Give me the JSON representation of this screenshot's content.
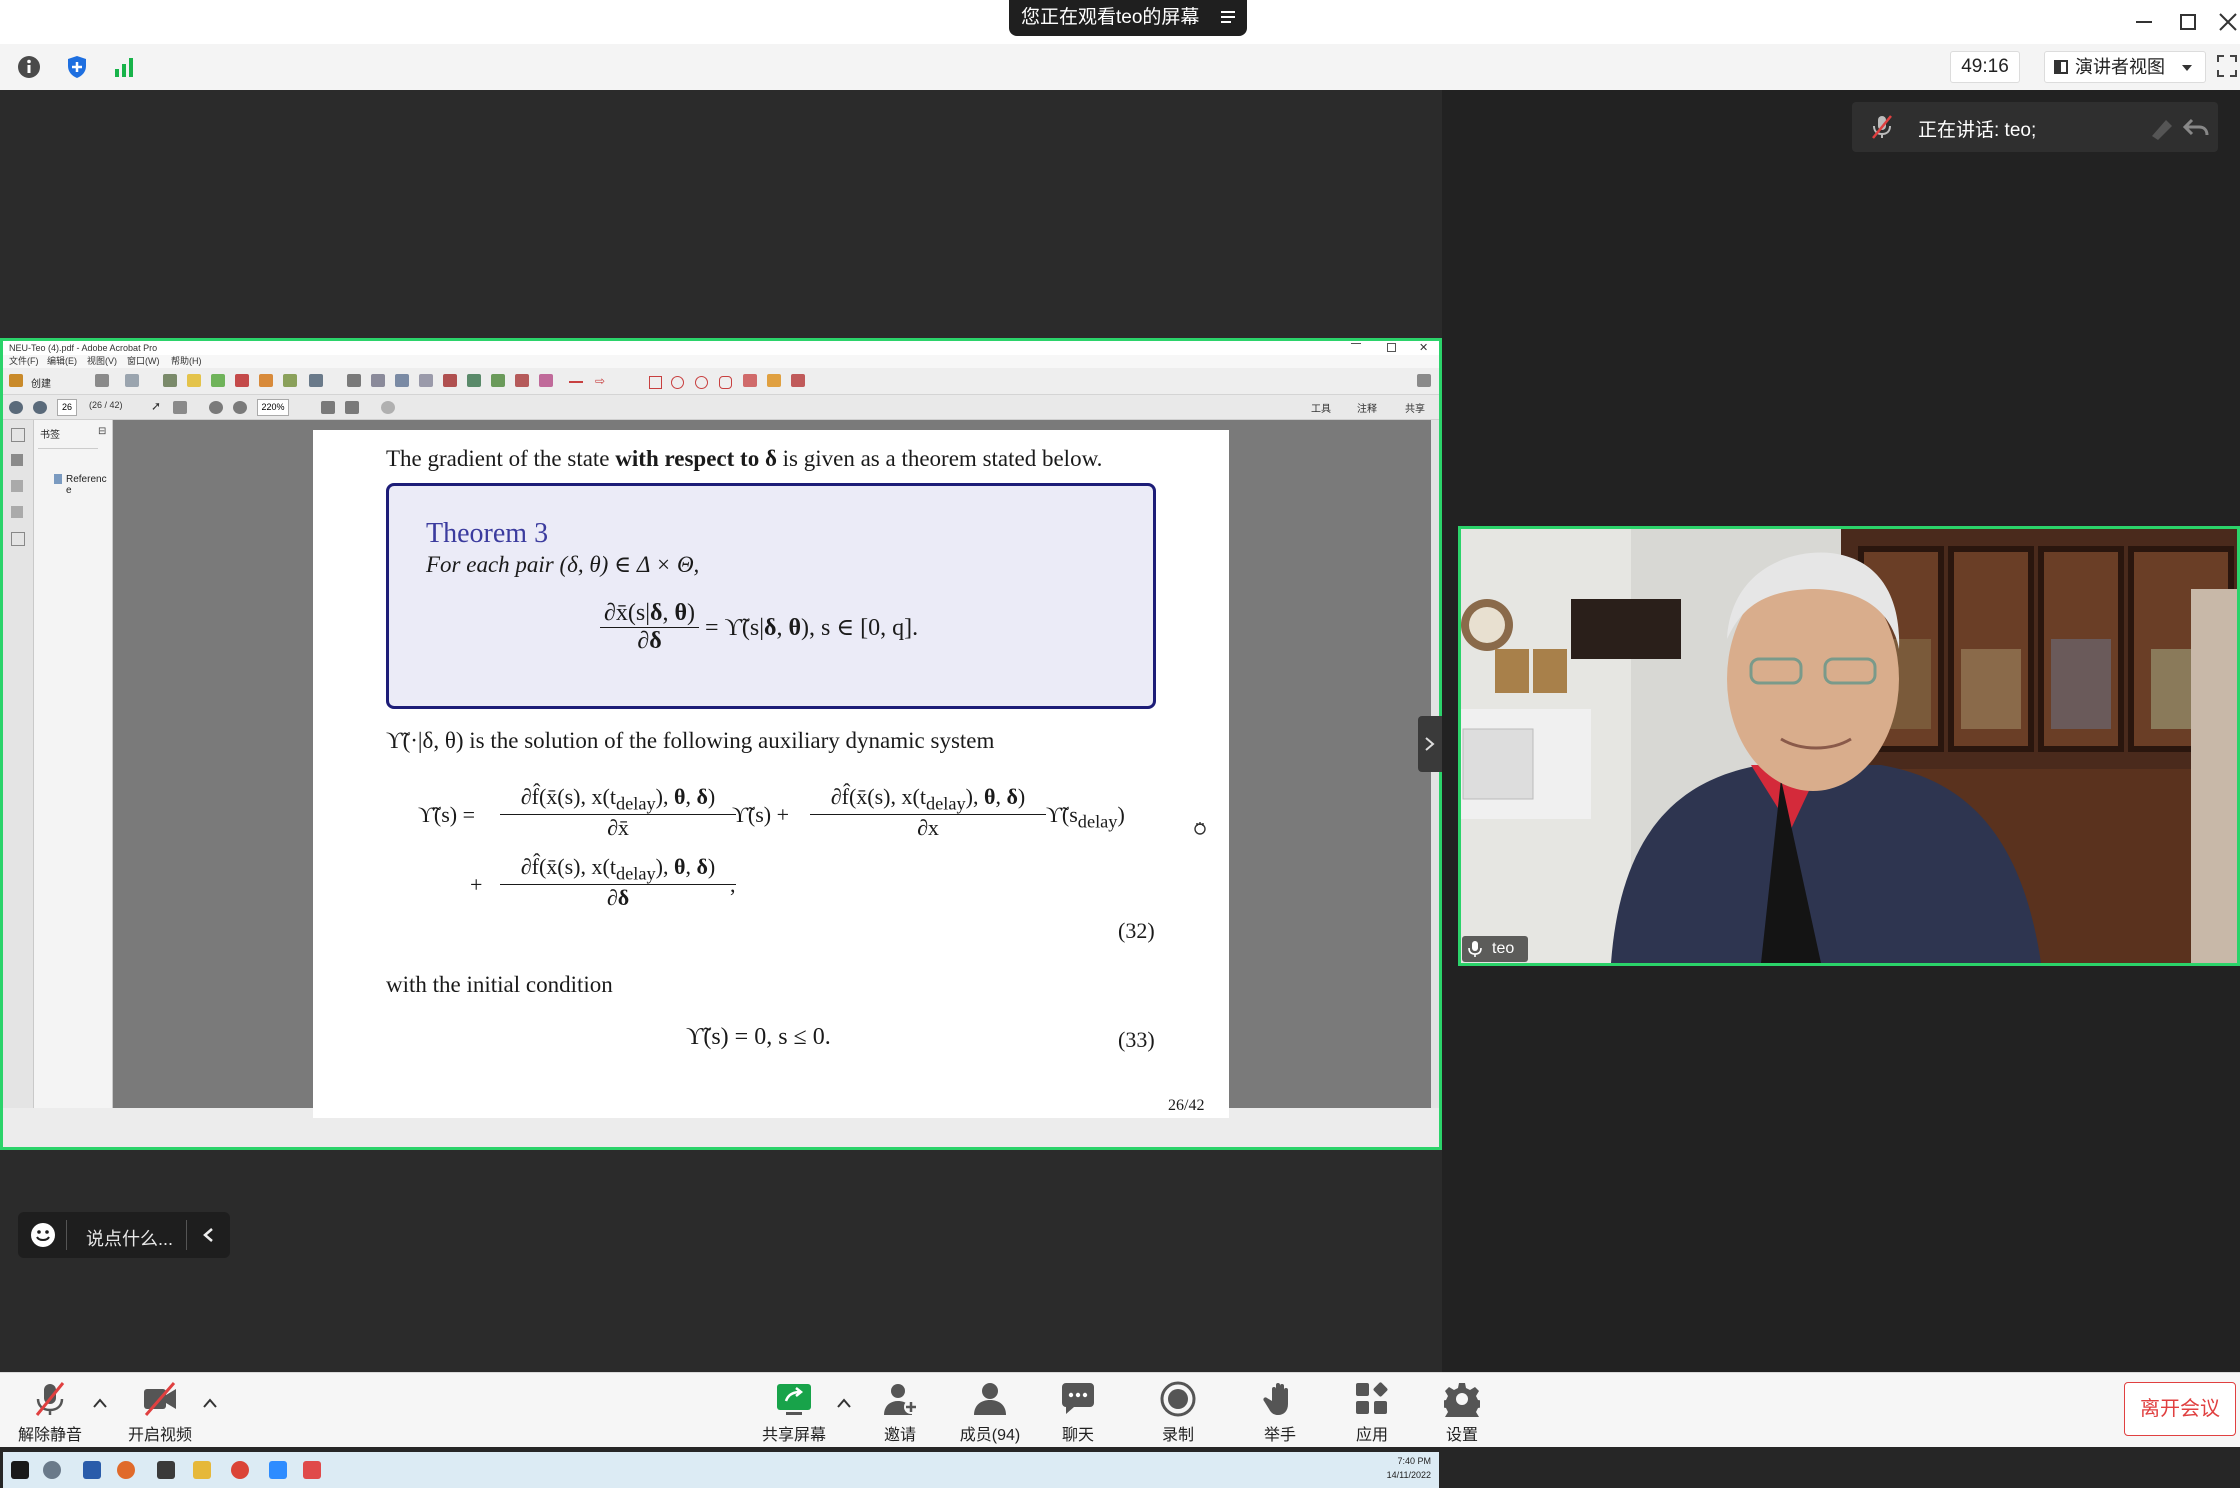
{
  "window": {
    "share_notice": "您正在观看teo的屏幕",
    "timer": "49:16",
    "view_mode": "演讲者视图"
  },
  "speaking": {
    "label": "正在讲话: teo;"
  },
  "video": {
    "participant_name": "teo"
  },
  "chat": {
    "placeholder": "说点什么..."
  },
  "acrobat": {
    "title": "NEU-Teo (4).pdf - Adobe Acrobat Pro",
    "menu": [
      "文件(F)",
      "编辑(E)",
      "视图(V)",
      "窗口(W)",
      "帮助(H)"
    ],
    "create_label": "创建",
    "page_input": "26",
    "page_count": "(26 / 42)",
    "zoom": "220%",
    "right_tabs": [
      "工具",
      "注释",
      "共享"
    ],
    "panel_title": "书签",
    "bookmark": "Reference",
    "clock_time": "7:40 PM",
    "clock_date": "14/11/2022"
  },
  "slide": {
    "line1_a": "The gradient of the state ",
    "line1_b": "with respect to δ",
    "line1_c": " is given as a theorem stated below.",
    "theorem_title": "Theorem 3",
    "theorem_text": "For each pair (δ, θ) ∈ Δ × Θ,",
    "desc": "ϒ̃(·|δ, θ) is the solution of the following auxiliary dynamic system",
    "eqnum_32": "(32)",
    "condition": "with the initial condition",
    "eq33": "ϒ̃(s) = 0,  s ≤ 0.",
    "eqnum_33": "(33)",
    "page_number": "26/42"
  },
  "toolbar": {
    "unmute": "解除静音",
    "video": "开启视频",
    "share": "共享屏幕",
    "invite": "邀请",
    "participants": "成员(94)",
    "chat": "聊天",
    "record": "录制",
    "raise_hand": "举手",
    "apps": "应用",
    "settings": "设置",
    "leave": "离开会议"
  },
  "colors": {
    "share_border": "#2bd36a",
    "theorem_border": "#1d1d78",
    "theorem_title": "#3b3b9e",
    "leave_red": "#e04040"
  }
}
